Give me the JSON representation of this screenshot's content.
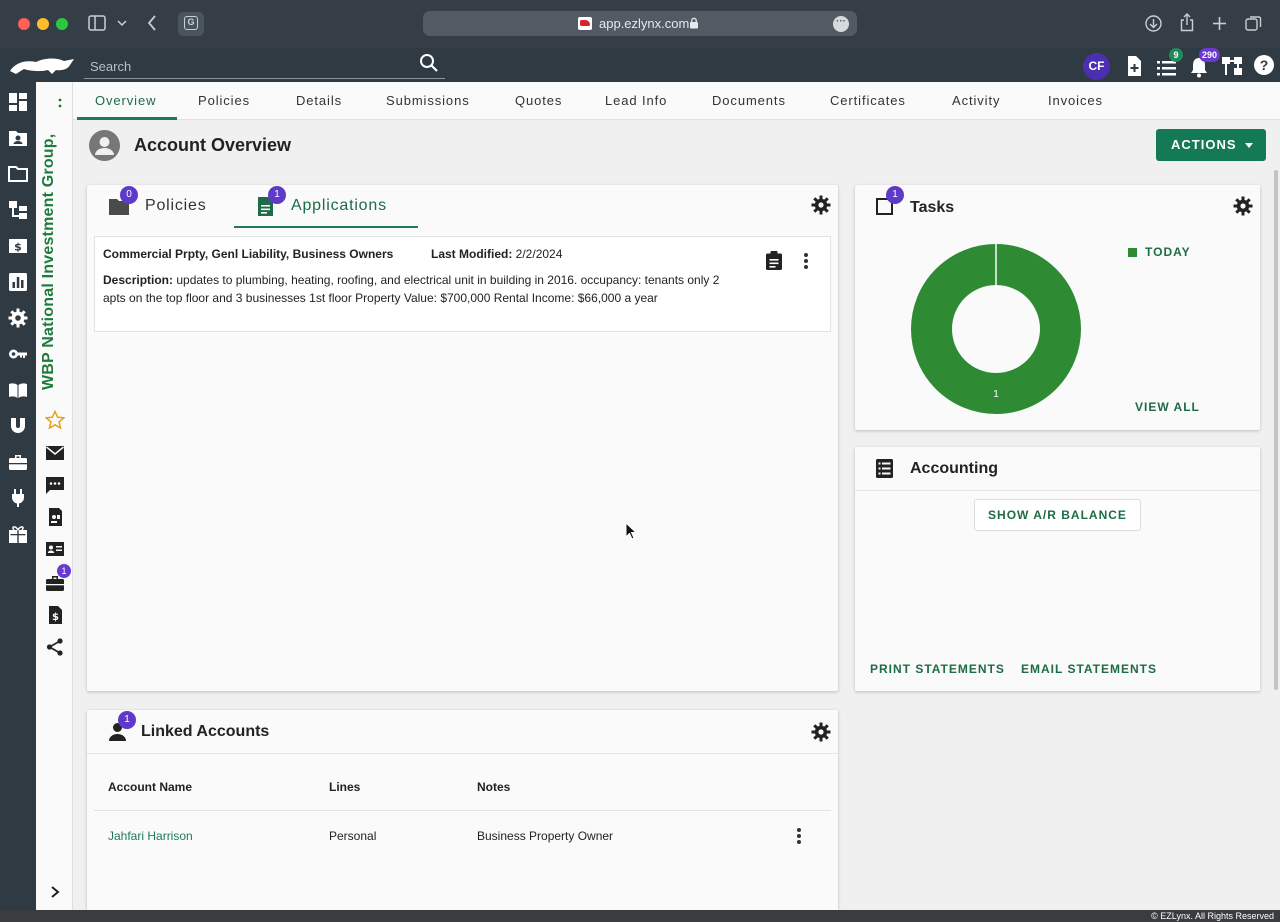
{
  "browser": {
    "url": "app.ezlynx.com",
    "tab_favicon_letter": "G"
  },
  "header": {
    "search_placeholder": "Search",
    "user_initials": "CF",
    "list_badge": "9",
    "notification_badge": "290",
    "colors": {
      "avatar": "#4b2fb2",
      "list_badge": "#1f8a5a",
      "notification_badge": "#6a3ad0"
    }
  },
  "account": {
    "name": "WBP National Investment Group,",
    "strip_badge": "1"
  },
  "tabs": [
    {
      "label": "Overview",
      "active": true
    },
    {
      "label": "Policies"
    },
    {
      "label": "Details"
    },
    {
      "label": "Submissions"
    },
    {
      "label": "Quotes"
    },
    {
      "label": "Lead Info"
    },
    {
      "label": "Documents"
    },
    {
      "label": "Certificates"
    },
    {
      "label": "Activity"
    },
    {
      "label": "Invoices"
    }
  ],
  "page": {
    "title": "Account Overview",
    "actions_label": "ACTIONS"
  },
  "policies_card": {
    "policies_tab": "Policies",
    "policies_count": "0",
    "applications_tab": "Applications",
    "applications_count": "1",
    "application": {
      "title": "Commercial Prpty, Genl Liability, Business Owners",
      "last_modified_label": "Last Modified:",
      "last_modified_value": "2/2/2024",
      "description_label": "Description:",
      "description_value": "updates to plumbing, heating, roofing, and electrical unit in building in 2016. occupancy: tenants only 2 apts on the top floor and 3 businesses 1st floor Property Value: $700,000 Rental Income: $66,000 a year"
    }
  },
  "tasks_card": {
    "title": "Tasks",
    "count": "1",
    "legend": "TODAY",
    "view_all": "VIEW ALL",
    "chart_label": "1",
    "colors": {
      "today": "#2e8b34"
    }
  },
  "chart_data": {
    "type": "pie",
    "categories": [
      "TODAY"
    ],
    "values": [
      1
    ],
    "title": "",
    "legend_placement": "right"
  },
  "accounting_card": {
    "title": "Accounting",
    "show_balance": "SHOW A/R BALANCE",
    "print_statements": "PRINT STATEMENTS",
    "email_statements": "EMAIL STATEMENTS"
  },
  "linked_card": {
    "title": "Linked Accounts",
    "count": "1",
    "columns": [
      "Account Name",
      "Lines",
      "Notes"
    ],
    "rows": [
      {
        "account_name": "Jahfari Harrison",
        "lines": "Personal",
        "notes": "Business Property Owner"
      }
    ]
  },
  "footer": {
    "copyright": "© EZLynx. All Rights Reserved"
  }
}
